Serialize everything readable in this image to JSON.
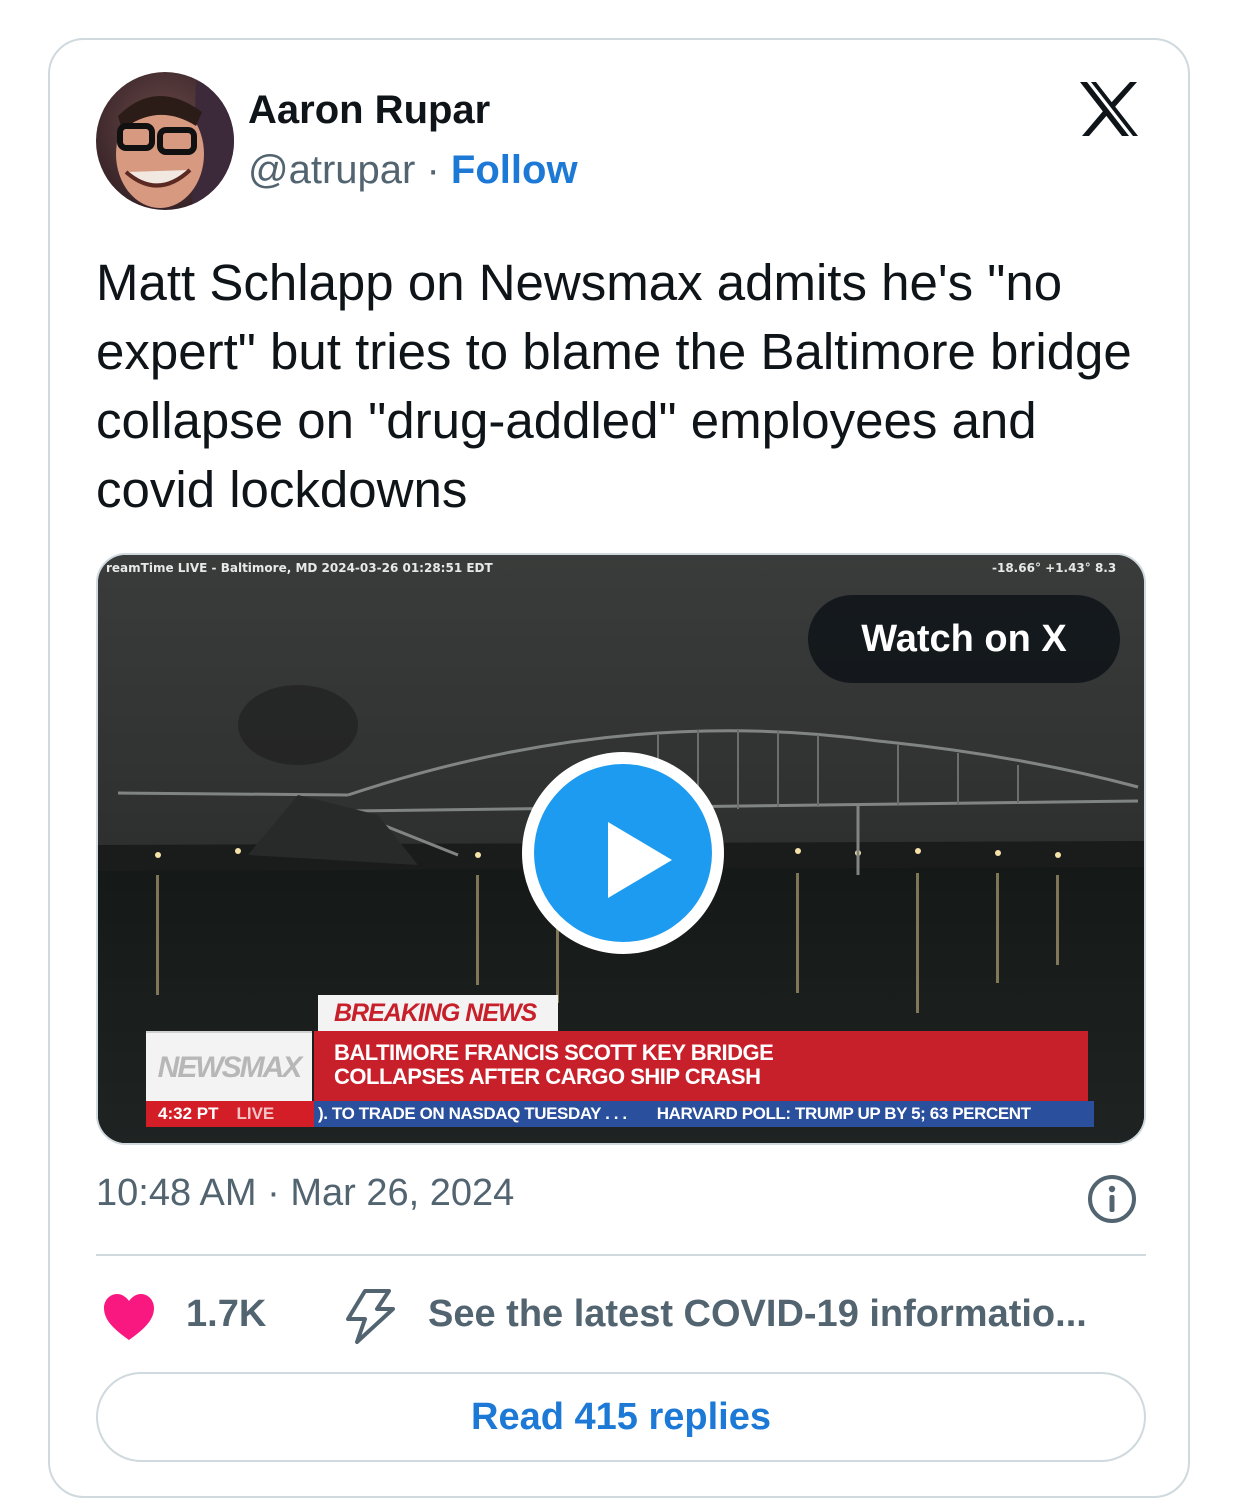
{
  "author": {
    "name": "Aaron Rupar",
    "handle": "@atrupar",
    "separator": "·",
    "follow_label": "Follow"
  },
  "tweet": {
    "text": "Matt Schlapp on Newsmax admits he's \"no expert\" but tries to blame the Baltimore bridge collapse on \"drug-addled\" employees and covid lockdowns"
  },
  "media": {
    "camera_label": "reamTime LIVE - Baltimore, MD 2024-03-26  01:28:51 EDT",
    "weather_label": "-18.66°  +1.43°  8.3",
    "watch_label": "Watch on X",
    "chyron": {
      "breaking": "BREAKING NEWS",
      "network": "NEWSMAX",
      "headline_line1": "BALTIMORE FRANCIS SCOTT KEY BRIDGE",
      "headline_line2": "COLLAPSES AFTER CARGO SHIP CRASH",
      "time": "4:32 PT",
      "live": "LIVE",
      "ticker1": "). TO TRADE ON NASDAQ TUESDAY . . .",
      "ticker2": "HARVARD POLL: TRUMP UP BY 5; 63 PERCENT"
    }
  },
  "meta": {
    "timestamp": "10:48 AM · Mar 26, 2024"
  },
  "actions": {
    "like_count": "1.7K",
    "covid_link": "See the latest COVID-19 informatio...",
    "read_replies": "Read 415 replies"
  },
  "colors": {
    "follow_blue": "#1d79d6",
    "heart_pink": "#f91880",
    "play_blue": "#1d9bf0"
  },
  "icons": [
    "x-logo-icon",
    "play-icon",
    "info-icon",
    "heart-icon",
    "bolt-icon"
  ]
}
